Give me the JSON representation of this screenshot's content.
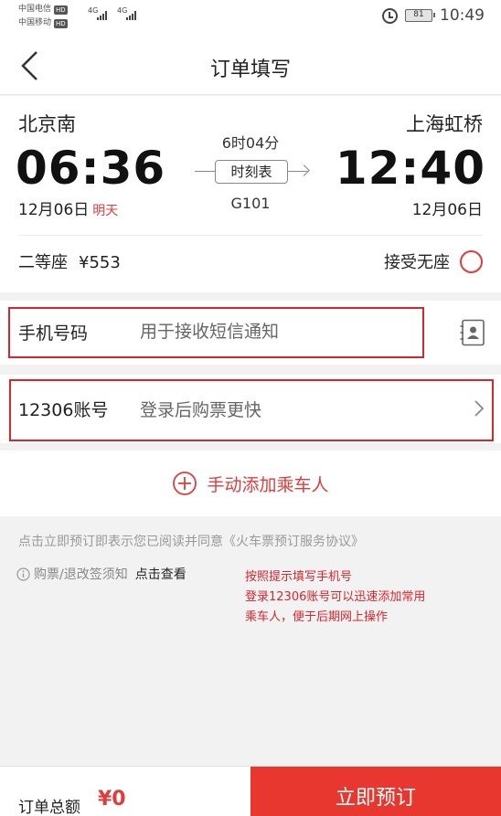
{
  "status_bar": {
    "carrier1": "中国电信",
    "carrier2": "中国移动",
    "hd": "HD",
    "net": "4G",
    "battery": "81",
    "time": "10:49"
  },
  "header": {
    "title": "订单填写"
  },
  "trip": {
    "from_station": "北京南",
    "to_station": "上海虹桥",
    "depart_time": "06:36",
    "arrive_time": "12:40",
    "depart_date": "12月06日",
    "depart_date_tag": "明天",
    "arrive_date": "12月06日",
    "duration": "6时04分",
    "timetable_label": "时刻表",
    "train_number": "G101",
    "seat_class": "二等座",
    "price": "¥553",
    "accept_no_seat_label": "接受无座"
  },
  "form": {
    "phone_label": "手机号码",
    "phone_placeholder": "用于接收短信通知",
    "account_label": "12306账号",
    "account_hint": "登录后购票更快",
    "add_passenger_label": "手动添加乘车人"
  },
  "notes": {
    "agreement": "点击立即预订即表示您已阅读并同意《火车票预订服务协议》",
    "ticket_notice": "购票/退改签须知",
    "ticket_notice_link": "点击查看",
    "annotation_line1": "按照提示填写手机号",
    "annotation_line2": "登录12306账号可以迅速添加常用",
    "annotation_line3": "乘车人，便于后期网上操作"
  },
  "footer": {
    "total_label": "订单总额",
    "total_amount": "¥0",
    "submit_label": "立即预订"
  },
  "colors": {
    "accent": "#e03c3c",
    "highlight_box": "#d9262c",
    "submit_bg": "#e8372f"
  }
}
